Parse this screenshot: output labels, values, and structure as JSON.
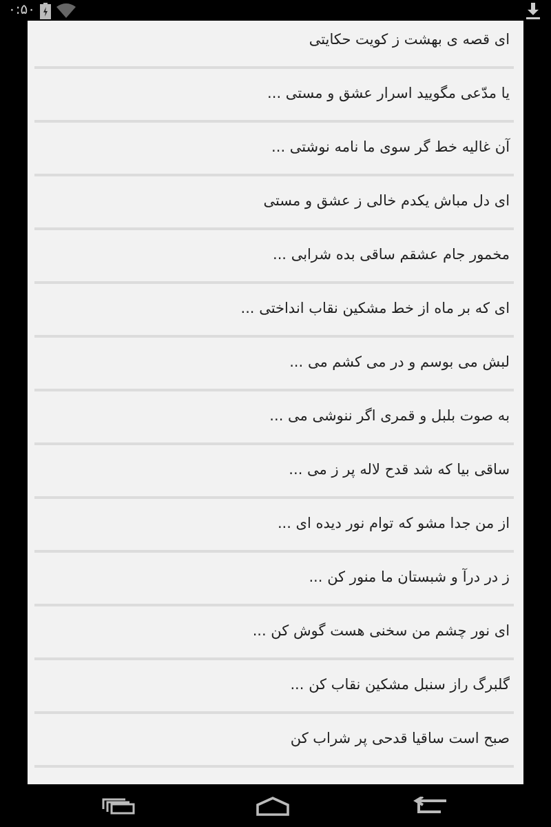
{
  "status_bar": {
    "time": "۰:۵۰"
  },
  "poems": [
    {
      "title": "ای قصه ی بهشت ز کویت حکایتی"
    },
    {
      "title": "یا مدّعی مگویید اسرار عشق و مستی ..."
    },
    {
      "title": "آن غالیه خط گر سوی ما نامه نوشتی ..."
    },
    {
      "title": "ای دل مباش یکدم خالی ز عشق و مستی"
    },
    {
      "title": "مخمور جام عشقم ساقی بده شرابی ..."
    },
    {
      "title": "ای که بر ماه از خط مشکین نقاب انداختی ..."
    },
    {
      "title": "لبش می بوسم و در می کشم می ..."
    },
    {
      "title": "به صوت بلبل و قمری اگر ننوشی می ..."
    },
    {
      "title": "ساقی بیا که شد قدح لاله پر ز می ..."
    },
    {
      "title": "از من جدا مشو که توام نور دیده ای ..."
    },
    {
      "title": "ز در درآ و شبستان ما منور کن ..."
    },
    {
      "title": "ای نور چشم من سخنی هست گوش کن ..."
    },
    {
      "title": "گلبرگ راز سنبل مشکین نقاب کن ..."
    },
    {
      "title": "صبح است ساقیا قدحی پر شراب کن"
    }
  ]
}
